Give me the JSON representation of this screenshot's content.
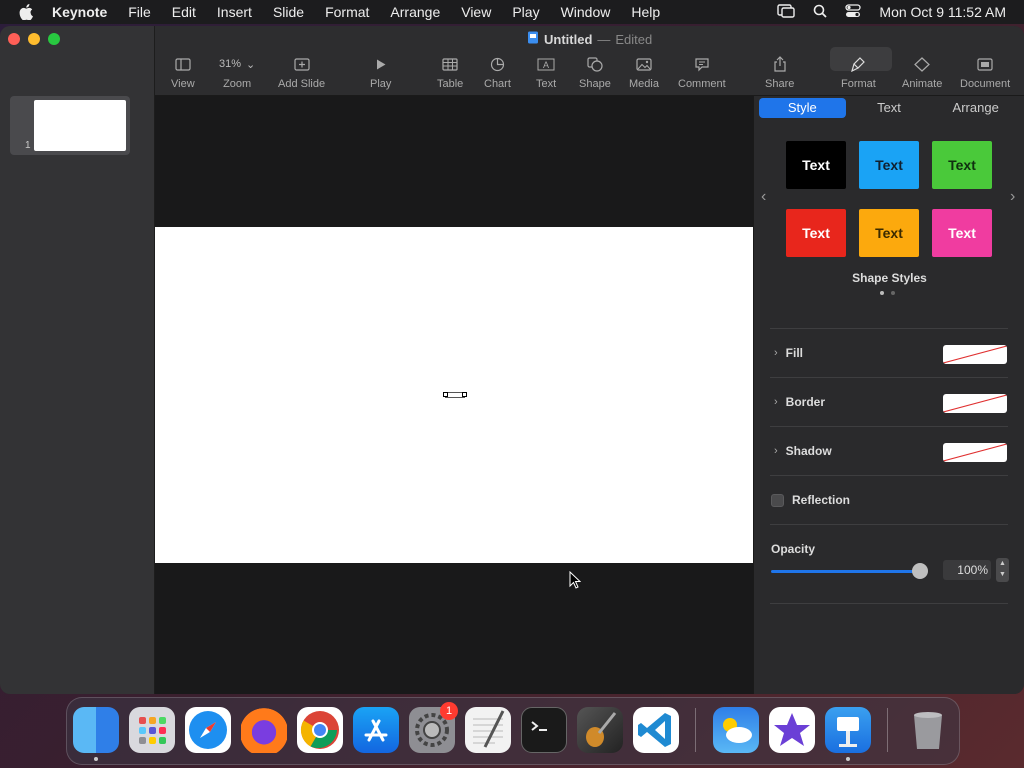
{
  "menubar": {
    "items": [
      "Keynote",
      "File",
      "Edit",
      "Insert",
      "Slide",
      "Format",
      "Arrange",
      "View",
      "Play",
      "Window",
      "Help"
    ],
    "clock": "Mon Oct 9  11:52 AM"
  },
  "window": {
    "title": "Untitled",
    "dash": "—",
    "status": "Edited"
  },
  "toolbar": {
    "zoom_value": "31%",
    "labels": {
      "view": "View",
      "zoom": "Zoom",
      "add_slide": "Add Slide",
      "play": "Play",
      "table": "Table",
      "chart": "Chart",
      "text": "Text",
      "shape": "Shape",
      "media": "Media",
      "comment": "Comment",
      "share": "Share",
      "format": "Format",
      "animate": "Animate",
      "document": "Document"
    }
  },
  "navigator": {
    "slide_number": "1"
  },
  "inspector": {
    "tabs": [
      "Style",
      "Text",
      "Arrange"
    ],
    "swatch_text": "Text",
    "swatch_colors": [
      "#000000",
      "#1aa3f5",
      "#4ac93a",
      "#e8261c",
      "#fca90d",
      "#f03ca0"
    ],
    "swatch_text_colors": [
      "#ffffff",
      "#102030",
      "#103010",
      "#ffffff",
      "#3a2a00",
      "#ffffff"
    ],
    "shape_styles_label": "Shape Styles",
    "fill_label": "Fill",
    "border_label": "Border",
    "shadow_label": "Shadow",
    "reflection_label": "Reflection",
    "opacity_label": "Opacity",
    "opacity_value": "100%"
  },
  "dock": {
    "apps": [
      "Finder",
      "Launchpad",
      "Safari",
      "Firefox",
      "Chrome",
      "App Store",
      "System Settings",
      "TextEdit",
      "Terminal",
      "GarageBand",
      "VS Code",
      "Weather",
      "iMovie",
      "Keynote",
      "Trash"
    ],
    "settings_badge": "1"
  },
  "colors": {
    "accent": "#1f75ea"
  }
}
